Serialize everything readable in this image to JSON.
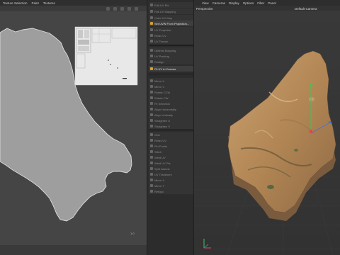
{
  "uv_editor": {
    "menu": [
      "Texture Selection",
      "Paint",
      "Textures"
    ],
    "coordinate_label": "1.0"
  },
  "uv_manager": {
    "buttons": [
      {
        "label": "Edit UV Pts"
      },
      {
        "label": "Flat UV Mapping"
      },
      {
        "label": "Cube UV Map"
      },
      {
        "label": "Set UVW From Projection...",
        "active": true
      },
      {
        "label": "UV Projection"
      },
      {
        "label": "Relax UV"
      },
      {
        "label": "UV Terrain"
      },
      {
        "label": "Optimal Mapping"
      },
      {
        "label": "UV Packing"
      },
      {
        "label": "Realign"
      },
      {
        "label": "Fit UV to Canvas",
        "active": true
      },
      {
        "label": "Mirror U"
      },
      {
        "label": "Mirror V"
      },
      {
        "label": "Rotate CCW"
      },
      {
        "label": "Rotate CW"
      },
      {
        "label": "Fit Selection"
      },
      {
        "label": "Align Horizontally"
      },
      {
        "label": "Align Vertically"
      },
      {
        "label": "Straighten U"
      },
      {
        "label": "Straighten V"
      },
      {
        "label": "Grid"
      },
      {
        "label": "Relax UV"
      },
      {
        "label": "Pin Points"
      },
      {
        "label": "Stitch"
      },
      {
        "label": "Weld UV"
      },
      {
        "label": "Weld UV Pts"
      },
      {
        "label": "Split Islands"
      },
      {
        "label": "UV Transform"
      },
      {
        "label": "Mirror X"
      },
      {
        "label": "Mirror Y"
      },
      {
        "label": "Retopo"
      }
    ]
  },
  "viewport": {
    "menu": [
      "View",
      "Cameras",
      "Display",
      "Options",
      "Filter",
      "Panel"
    ],
    "projection": "Perspective",
    "camera": "Default Camera"
  },
  "colors": {
    "uv_island_fill": "#9e9e9e",
    "active_icon": "#d9a030",
    "axis_y": "#3fc35f",
    "axis_x": "#e04848",
    "axis_z": "#4a70e0"
  }
}
